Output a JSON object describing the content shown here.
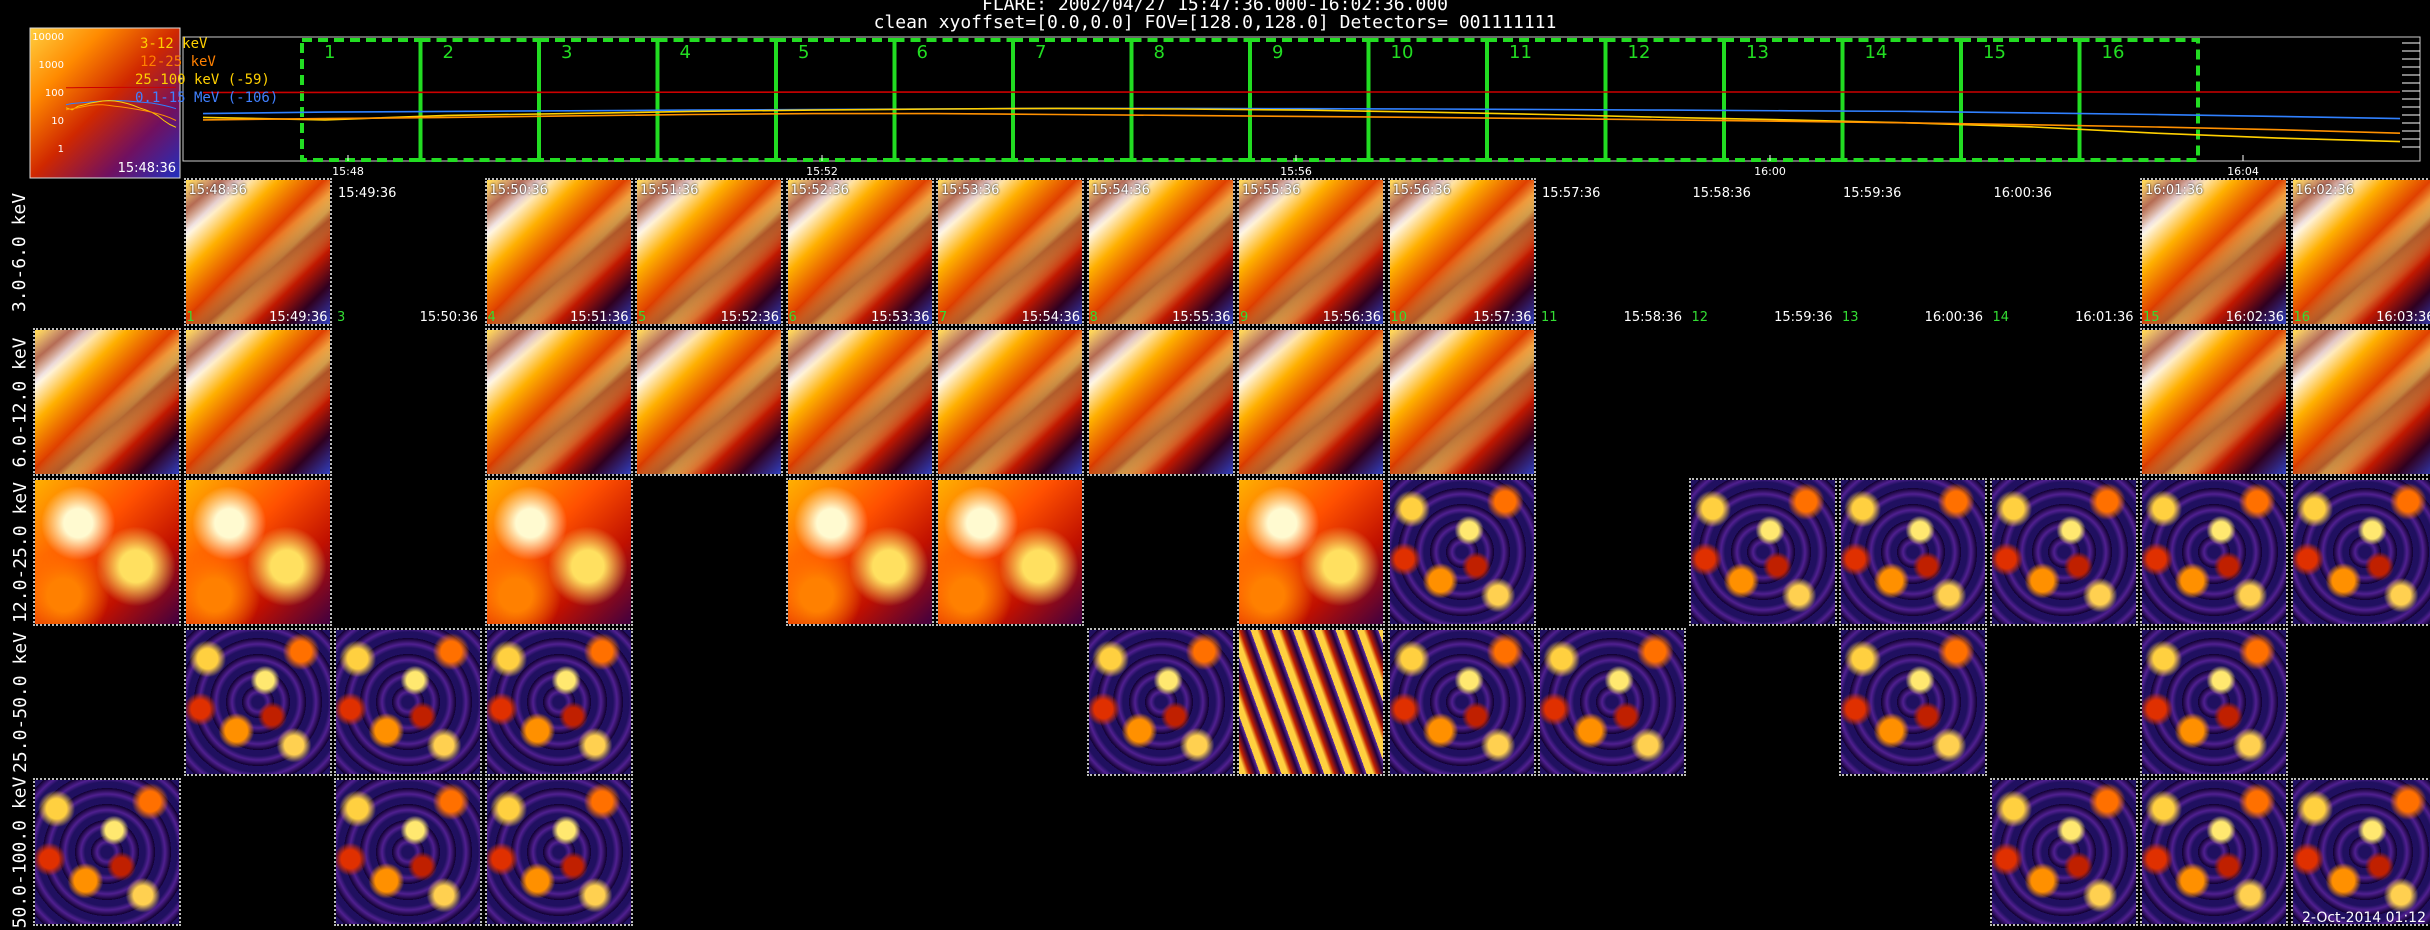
{
  "header": {
    "title": "FLARE: 2002/04/27 15:47:36.000-16:02:36.000",
    "subtitle": "clean    xyoffset=[0.0,0.0]    FOV=[128.0,128.0]    Detectors= 001111111"
  },
  "chart_data": {
    "type": "line",
    "title": "",
    "xlabel": "",
    "ylabel": "",
    "x_ticks": [
      "15:48",
      "15:52",
      "15:56",
      "16:00",
      "16:04"
    ],
    "y_ticks": [
      "10000",
      "1000",
      "100",
      "10",
      "1"
    ],
    "ylim": [
      1,
      10000
    ],
    "yscale": "log",
    "legend_placement": "top-left",
    "legend": [
      {
        "label": "3-12 keV",
        "color": "#ffd000"
      },
      {
        "label": "12-25 keV",
        "color": "#ff8000"
      },
      {
        "label": "25-100 keV (-59)",
        "color": "#ffd000"
      },
      {
        "label": "0.1-15 MeV (-106)",
        "color": "#4080ff"
      }
    ],
    "x": [
      0,
      1,
      2,
      3,
      4,
      5,
      6,
      7,
      8,
      9,
      10,
      11,
      12,
      13,
      14,
      15,
      16,
      17,
      18
    ],
    "series": [
      {
        "color": "#cc0000",
        "values": [
          170,
          172,
          173,
          174,
          175,
          176,
          176,
          176,
          177,
          178,
          178,
          178,
          178,
          178,
          178,
          178,
          178,
          178,
          178
        ]
      },
      {
        "color": "#3080ff",
        "values": [
          30,
          34,
          36,
          38,
          40,
          42,
          44,
          46,
          46,
          45,
          44,
          42,
          40,
          38,
          36,
          32,
          28,
          24,
          20
        ]
      },
      {
        "color": "#ffd000",
        "values": [
          22,
          18,
          26,
          30,
          36,
          40,
          44,
          46,
          44,
          40,
          34,
          28,
          22,
          18,
          14,
          10,
          6,
          4,
          3
        ]
      },
      {
        "color": "#ff9000",
        "values": [
          18,
          20,
          22,
          25,
          28,
          30,
          30,
          28,
          26,
          24,
          22,
          20,
          18,
          16,
          14,
          12,
          10,
          8,
          6
        ]
      }
    ],
    "intervals": [
      "1",
      "2",
      "3",
      "4",
      "5",
      "6",
      "7",
      "8",
      "9",
      "10",
      "11",
      "12",
      "13",
      "14",
      "15",
      "16"
    ],
    "inset_time": "15:48:36"
  },
  "rows": [
    {
      "label": "3.0-6.0 keV"
    },
    {
      "label": "6.0-12.0 keV"
    },
    {
      "label": "12.0-25.0 keV"
    },
    {
      "label": "25.0-50.0 keV"
    },
    {
      "label": "50.0-100.0 keV"
    }
  ],
  "row1_tiles": [
    {
      "col": 1,
      "time": "15:48:36",
      "pattern": "diag"
    },
    {
      "col": 3,
      "time": "15:50:36",
      "pattern": "diag"
    },
    {
      "col": 4,
      "time": "15:51:36",
      "pattern": "diag"
    },
    {
      "col": 5,
      "time": "15:52:36",
      "pattern": "diag"
    },
    {
      "col": 6,
      "time": "15:53:36",
      "pattern": "diag"
    },
    {
      "col": 7,
      "time": "15:54:36",
      "pattern": "diag"
    },
    {
      "col": 8,
      "time": "15:55:36",
      "pattern": "diag"
    },
    {
      "col": 9,
      "time": "15:56:36",
      "pattern": "diag"
    },
    {
      "col": 14,
      "time": "16:01:36",
      "pattern": "diag"
    },
    {
      "col": 15,
      "time": "16:02:36",
      "pattern": "diag"
    }
  ],
  "row1_empty": [
    {
      "col": 2,
      "time": "15:49:36"
    },
    {
      "col": 10,
      "time": "15:57:36"
    },
    {
      "col": 11,
      "time": "15:58:36"
    },
    {
      "col": 12,
      "time": "15:59:36"
    },
    {
      "col": 13,
      "time": "16:00:36"
    }
  ],
  "row2_labels": [
    {
      "col": 1,
      "num": "1",
      "time": "15:49:36"
    },
    {
      "col": 2,
      "num": "3",
      "time": "15:50:36"
    },
    {
      "col": 3,
      "num": "4",
      "time": "15:51:36"
    },
    {
      "col": 4,
      "num": "5",
      "time": "15:52:36"
    },
    {
      "col": 5,
      "num": "6",
      "time": "15:53:36"
    },
    {
      "col": 6,
      "num": "7",
      "time": "15:54:36"
    },
    {
      "col": 7,
      "num": "8",
      "time": "15:55:36"
    },
    {
      "col": 8,
      "num": "9",
      "time": "15:56:36"
    },
    {
      "col": 9,
      "num": "10",
      "time": "15:57:36"
    },
    {
      "col": 10,
      "num": "11",
      "time": "15:58:36"
    },
    {
      "col": 11,
      "num": "12",
      "time": "15:59:36"
    },
    {
      "col": 12,
      "num": "13",
      "time": "16:00:36"
    },
    {
      "col": 13,
      "num": "14",
      "time": "16:01:36"
    },
    {
      "col": 14,
      "num": "15",
      "time": "16:02:36"
    },
    {
      "col": 15,
      "num": "16",
      "time": "16:03:36"
    }
  ],
  "grid_tiles": [
    {
      "row": 1,
      "col": 0,
      "pattern": "diag"
    },
    {
      "row": 1,
      "col": 1,
      "pattern": "diag"
    },
    {
      "row": 1,
      "col": 3,
      "pattern": "diag"
    },
    {
      "row": 1,
      "col": 4,
      "pattern": "diag"
    },
    {
      "row": 1,
      "col": 5,
      "pattern": "diag"
    },
    {
      "row": 1,
      "col": 6,
      "pattern": "diag"
    },
    {
      "row": 1,
      "col": 7,
      "pattern": "diag"
    },
    {
      "row": 1,
      "col": 8,
      "pattern": "diag"
    },
    {
      "row": 1,
      "col": 9,
      "pattern": "diag"
    },
    {
      "row": 1,
      "col": 14,
      "pattern": "diag"
    },
    {
      "row": 1,
      "col": 15,
      "pattern": "diag"
    },
    {
      "row": 2,
      "col": 0,
      "pattern": "mottled"
    },
    {
      "row": 2,
      "col": 1,
      "pattern": "mottled"
    },
    {
      "row": 2,
      "col": 3,
      "pattern": "mottled"
    },
    {
      "row": 2,
      "col": 5,
      "pattern": "mottled"
    },
    {
      "row": 2,
      "col": 6,
      "pattern": "mottled"
    },
    {
      "row": 2,
      "col": 8,
      "pattern": "mottled"
    },
    {
      "row": 2,
      "col": 9,
      "pattern": "noise"
    },
    {
      "row": 2,
      "col": 11,
      "pattern": "noise"
    },
    {
      "row": 2,
      "col": 12,
      "pattern": "noise"
    },
    {
      "row": 2,
      "col": 13,
      "pattern": "noise"
    },
    {
      "row": 2,
      "col": 14,
      "pattern": "noise"
    },
    {
      "row": 2,
      "col": 15,
      "pattern": "noise"
    },
    {
      "row": 3,
      "col": 1,
      "pattern": "noise"
    },
    {
      "row": 3,
      "col": 2,
      "pattern": "noise"
    },
    {
      "row": 3,
      "col": 3,
      "pattern": "noise"
    },
    {
      "row": 3,
      "col": 7,
      "pattern": "noise"
    },
    {
      "row": 3,
      "col": 8,
      "pattern": "stripes"
    },
    {
      "row": 3,
      "col": 9,
      "pattern": "noise"
    },
    {
      "row": 3,
      "col": 10,
      "pattern": "noise"
    },
    {
      "row": 3,
      "col": 12,
      "pattern": "noise"
    },
    {
      "row": 3,
      "col": 14,
      "pattern": "noise"
    },
    {
      "row": 4,
      "col": 0,
      "pattern": "noise"
    },
    {
      "row": 4,
      "col": 2,
      "pattern": "noise"
    },
    {
      "row": 4,
      "col": 3,
      "pattern": "noise"
    },
    {
      "row": 4,
      "col": 13,
      "pattern": "noise"
    },
    {
      "row": 4,
      "col": 14,
      "pattern": "noise"
    },
    {
      "row": 4,
      "col": 15,
      "pattern": "noise"
    }
  ],
  "footer": {
    "stamp": "2-Oct-2014 01:12"
  }
}
